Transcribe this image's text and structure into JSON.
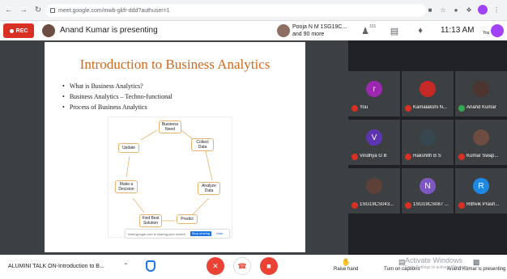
{
  "browser": {
    "url": "meet.google.com/mwb-gkfr-ddd?authuser=1",
    "nav": [
      "back-icon",
      "forward-icon",
      "reload-icon"
    ]
  },
  "topbar": {
    "rec_label": "REC",
    "presenting": "Anand Kumar is presenting",
    "pinned_name": "Pooja N M 1SG19C...",
    "pinned_more": "and 90 more",
    "participants_count": "101",
    "time": "11:13 AM",
    "you": "You"
  },
  "slide": {
    "title": "Introduction to Business Analytics",
    "bullets": [
      "What is Business Analytics?",
      "Business Analytics – Techno-functional",
      "Process of Business Analytics"
    ],
    "diagram_nodes": [
      "Business Need",
      "Collect Data",
      "Analyze Data",
      "Predict",
      "Find Best Solution",
      "Make a Decision",
      "Update"
    ],
    "share_text": "meet.google.com is sharing your screen",
    "share_stop": "Stop sharing",
    "share_hide": "Hide"
  },
  "participants": [
    {
      "initial": "r",
      "name": "You",
      "color": "#9c27b0"
    },
    {
      "initial": "",
      "name": "Kamalakshi N...",
      "color": "#c62828"
    },
    {
      "initial": "",
      "name": "Anand Kumar",
      "color": "#4e342e"
    },
    {
      "initial": "V",
      "name": "Vindhya G B",
      "color": "#5e35b1"
    },
    {
      "initial": "",
      "name": "Rakshith B S",
      "color": "#37474f"
    },
    {
      "initial": "",
      "name": "Kumar Swap...",
      "color": "#6d4c41"
    },
    {
      "initial": "",
      "name": "1SG19CS043...",
      "color": "#5d4037"
    },
    {
      "initial": "N",
      "name": "1SG19CS087 ...",
      "color": "#7e57c2"
    },
    {
      "initial": "R",
      "name": "Rithvik Prash...",
      "color": "#1e88e5"
    }
  ],
  "bottombar": {
    "meeting_title": "ALUMINI TALK ON-Introduction to B...",
    "raise_hand": "Raise hand",
    "captions": "Turn on captions",
    "presenting_self": "Anand Kumar is presenting",
    "watermark": "Activate Windows",
    "watermark_sub": "Go to Settings to activate Windows."
  },
  "colors": {
    "accent": "#1a73e8",
    "danger": "#ea4335",
    "slide_title": "#d2691e"
  }
}
